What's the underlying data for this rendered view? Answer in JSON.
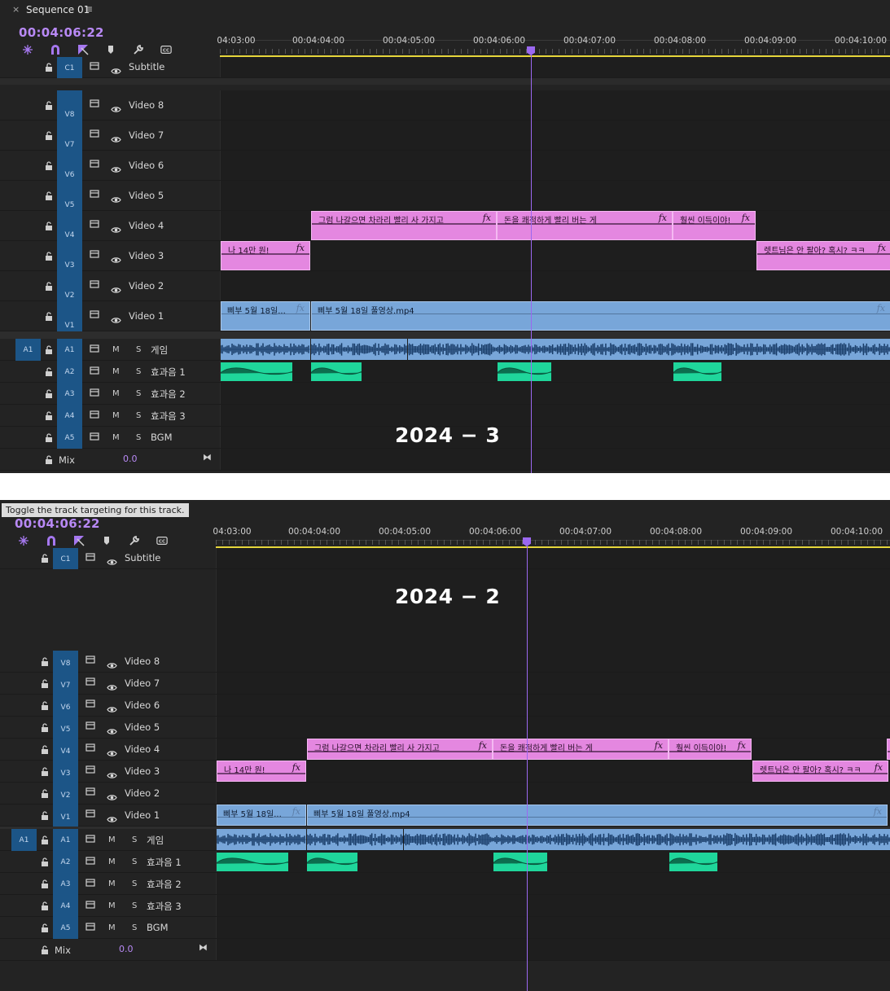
{
  "sequence_tab": {
    "close": "×",
    "title": "Sequence 01",
    "menu": "≡"
  },
  "tooltip": "Toggle the track targeting for this track.",
  "panels": [
    {
      "stamp": "2024 − 3",
      "timecode": "00:04:06:22"
    },
    {
      "stamp": "2024 − 2",
      "timecode": "00:04:06:22"
    }
  ],
  "ruler_labels": [
    "00:04:03:00",
    "00:04:04:00",
    "00:04:05:00",
    "00:04:06:00",
    "00:04:07:00",
    "00:04:08:00",
    "00:04:09:00",
    "00:04:10:00"
  ],
  "ruler_first_clipped": "04:03:00",
  "tools": [
    "snap-icon",
    "magnet-icon",
    "linked-selection-icon",
    "marker-icon",
    "wrench-icon",
    "captions-icon"
  ],
  "tracks": {
    "subtitle": {
      "target": "C1",
      "name": "Subtitle"
    },
    "video": [
      {
        "target": "V8",
        "name": "Video 8"
      },
      {
        "target": "V7",
        "name": "Video 7"
      },
      {
        "target": "V6",
        "name": "Video 6"
      },
      {
        "target": "V5",
        "name": "Video 5"
      },
      {
        "target": "V4",
        "name": "Video 4"
      },
      {
        "target": "V3",
        "name": "Video 3"
      },
      {
        "target": "V2",
        "name": "Video 2"
      },
      {
        "target": "V1",
        "name": "Video 1"
      }
    ],
    "audio": [
      {
        "source": "A1",
        "target": "A1",
        "m": "M",
        "s": "S",
        "name": "게임"
      },
      {
        "source": "",
        "target": "A2",
        "m": "M",
        "s": "S",
        "name": "효과음 1"
      },
      {
        "source": "",
        "target": "A3",
        "m": "M",
        "s": "S",
        "name": "효과음 2"
      },
      {
        "source": "",
        "target": "A4",
        "m": "M",
        "s": "S",
        "name": "효과음 3"
      },
      {
        "source": "",
        "target": "A5",
        "m": "M",
        "s": "S",
        "name": "BGM"
      }
    ],
    "mix": {
      "name": "Mix",
      "value": "0.0"
    }
  },
  "clips": {
    "v4": [
      "그럼 나갈으면 차라리 빨리 사 가지고",
      "돈을 쾌적하게 빨리 버는 게",
      "훨씬 이득이야!"
    ],
    "v3": [
      "나 14만 원!",
      "렛트님은 안 팔아? 혹시? ㅋㅋ"
    ],
    "v1": [
      "삐부 5월 18일...",
      "삐부 5월 18일 풀영상.mp4"
    ],
    "fx": "fx"
  },
  "colors": {
    "accent": "#9b68f0",
    "timecode": "#b889f5",
    "target": "#1c5587",
    "video_clip": "#78a6d9",
    "title_clip": "#e487e0",
    "audio_fx": "#1fd69b",
    "workarea": "#e6d63b"
  }
}
